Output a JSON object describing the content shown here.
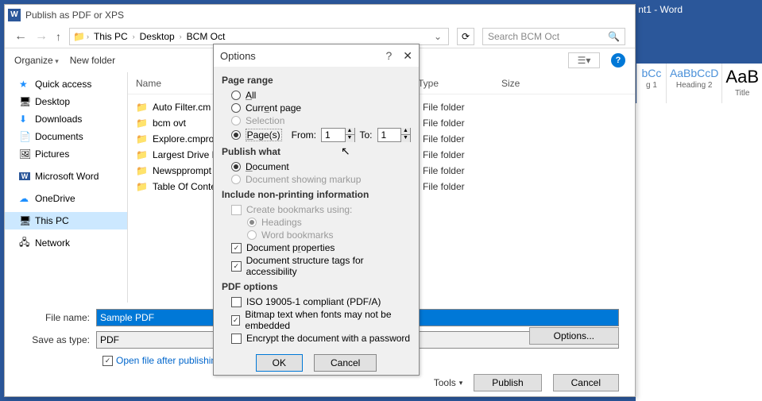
{
  "word": {
    "title": "nt1 - Word",
    "styles": [
      {
        "sample": "bCc",
        "label": "g 1"
      },
      {
        "sample": "AaBbCcD",
        "label": "Heading 2"
      },
      {
        "sample": "AaB",
        "label": "Title"
      }
    ]
  },
  "publish": {
    "title": "Publish as PDF or XPS",
    "breadcrumb": [
      "This PC",
      "Desktop",
      "BCM Oct"
    ],
    "search_placeholder": "Search BCM Oct",
    "organize": "Organize",
    "new_folder": "New folder",
    "columns": {
      "name": "Name",
      "type": "Type",
      "size": "Size"
    },
    "nav": [
      {
        "icon": "★",
        "label": "Quick access",
        "cls": "ni-star"
      },
      {
        "icon": "🖥",
        "label": "Desktop"
      },
      {
        "icon": "⬇",
        "label": "Downloads",
        "iconColor": "#1e90ff"
      },
      {
        "icon": "📄",
        "label": "Documents"
      },
      {
        "icon": "🖼",
        "label": "Pictures"
      },
      {
        "spacer": true
      },
      {
        "icon": "W",
        "label": "Microsoft Word",
        "iconBg": "#2b579a"
      },
      {
        "spacer": true
      },
      {
        "icon": "☁",
        "label": "OneDrive",
        "iconColor": "#1e90ff"
      },
      {
        "spacer": true
      },
      {
        "icon": "🖥",
        "label": "This PC",
        "selected": true
      },
      {
        "spacer": true
      },
      {
        "icon": "🖧",
        "label": "Network"
      }
    ],
    "files": [
      {
        "name": "Auto Filter.cm",
        "type": "File folder"
      },
      {
        "name": "bcm ovt",
        "type": "File folder"
      },
      {
        "name": "Explore.cmpro",
        "type": "File folder"
      },
      {
        "name": "Largest Drive F",
        "type": "File folder"
      },
      {
        "name": "Newspprompt",
        "type": "File folder"
      },
      {
        "name": "Table Of Conte",
        "type": "File folder"
      }
    ],
    "file_name_label": "File name:",
    "file_name_value": "Sample PDF",
    "save_as_label": "Save as type:",
    "save_as_value": "PDF",
    "open_after": "Open file after publishing",
    "options_btn": "Options...",
    "tools": "Tools",
    "publish_btn": "Publish",
    "cancel_btn": "Cancel"
  },
  "options": {
    "title": "Options",
    "page_range": "Page range",
    "all": "All",
    "current": "Current page",
    "selection": "Selection",
    "pages": "Page(s)",
    "from": "From:",
    "from_val": "1",
    "to": "To:",
    "to_val": "1",
    "publish_what": "Publish what",
    "document": "Document",
    "doc_markup": "Document showing markup",
    "include_nonprint": "Include non-printing information",
    "create_bookmarks": "Create bookmarks using:",
    "headings": "Headings",
    "word_bookmarks": "Word bookmarks",
    "doc_props": "Document properties",
    "doc_struct": "Document structure tags for accessibility",
    "pdf_options": "PDF options",
    "iso": "ISO 19005-1 compliant (PDF/A)",
    "bitmap": "Bitmap text when fonts may not be embedded",
    "encrypt": "Encrypt the document with a password",
    "ok": "OK",
    "cancel": "Cancel"
  }
}
